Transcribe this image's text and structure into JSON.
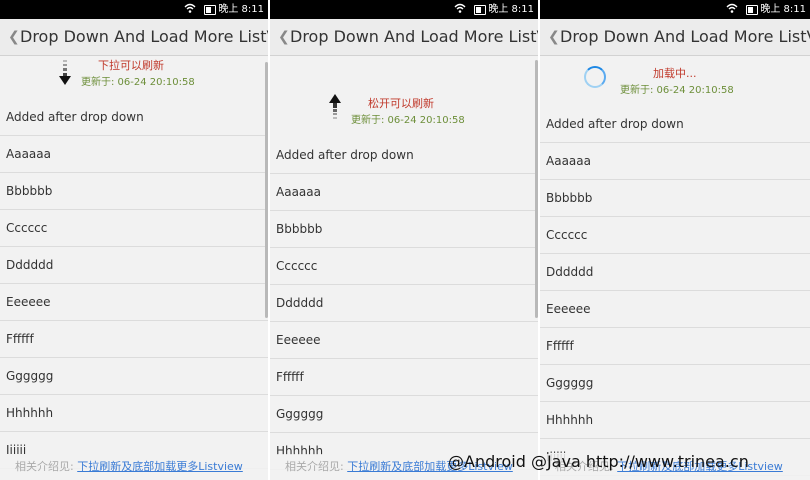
{
  "status_bar": {
    "time": "晚上 8:11"
  },
  "screens": [
    {
      "title": "Drop Down And Load More ListV...",
      "refresh_hint": "下拉可以刷新",
      "updated": "更新于: 06-24 20:10:58",
      "items": [
        "Added after drop down",
        "Aaaaaa",
        "Bbbbbb",
        "Cccccc",
        "Dddddd",
        "Eeeeee",
        "Ffffff",
        "Gggggg",
        "Hhhhhh",
        "Iiiiii"
      ],
      "footer_label": "相关介绍见:",
      "footer_link": "下拉刷新及底部加载更多Listview"
    },
    {
      "title": "Drop Down And Load More ListV...",
      "refresh_hint": "松开可以刷新",
      "updated": "更新于: 06-24 20:10:58",
      "items": [
        "Added after drop down",
        "Aaaaaa",
        "Bbbbbb",
        "Cccccc",
        "Dddddd",
        "Eeeeee",
        "Ffffff",
        "Gggggg",
        "Hhhhhh"
      ],
      "footer_label": "相关介绍见:",
      "footer_link": "下拉刷新及底部加载更多Listview"
    },
    {
      "title": "Drop Down And Load More ListV...",
      "refresh_hint": "加载中...",
      "updated": "更新于: 06-24 20:10:58",
      "items": [
        "Added after drop down",
        "Aaaaaa",
        "Bbbbbb",
        "Cccccc",
        "Dddddd",
        "Eeeeee",
        "Ffffff",
        "Gggggg",
        "Hhhhhh",
        "Iiiiii"
      ],
      "footer_label": "相关介绍见:",
      "footer_link": "下拉刷新及底部加载更多Listview"
    }
  ],
  "watermark": "@Android @Java http://www.trinea.cn",
  "colors": {
    "hint": "#c0392b",
    "updated": "#6d8f3a",
    "link": "#3a7bd5",
    "spinner": "#1e88e5"
  }
}
